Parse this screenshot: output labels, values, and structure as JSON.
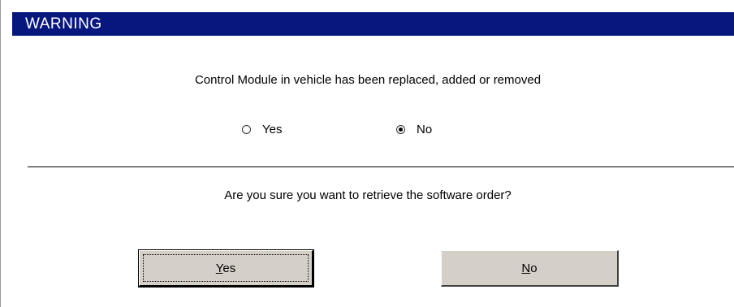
{
  "title": "WARNING",
  "question1": "Control Module in vehicle has been replaced, added or removed",
  "radio": {
    "selected": "No",
    "options": [
      {
        "mnemonic": "",
        "rest": "Yes"
      },
      {
        "mnemonic": "",
        "rest": "No"
      }
    ]
  },
  "question2": "Are you sure you want to retrieve the software order?",
  "buttons": {
    "yes": {
      "mnemonic": "Y",
      "rest": "es"
    },
    "no": {
      "mnemonic": "N",
      "rest": "o"
    }
  }
}
